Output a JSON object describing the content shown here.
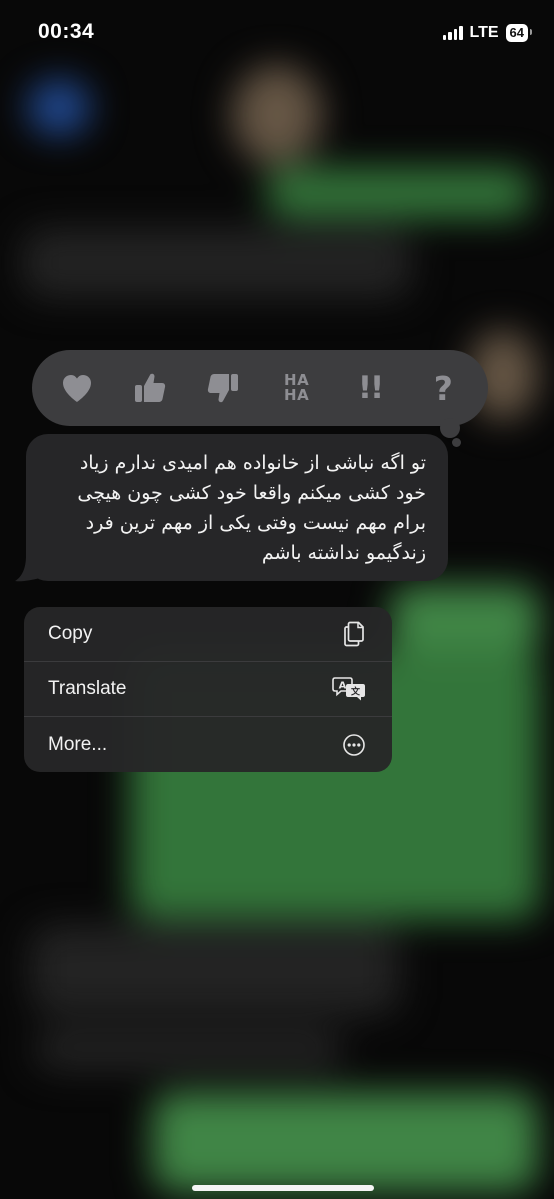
{
  "status_bar": {
    "time": "00:34",
    "network": "LTE",
    "battery": "64"
  },
  "tapback": {
    "reactions": [
      {
        "name": "heart-icon"
      },
      {
        "name": "thumbs-up-icon"
      },
      {
        "name": "thumbs-down-icon"
      },
      {
        "name": "haha-icon",
        "line1": "HA",
        "line2": "HA"
      },
      {
        "name": "exclamation-icon",
        "text": "!!"
      },
      {
        "name": "question-icon",
        "text": "?"
      }
    ],
    "icon_color": "#8e8e93",
    "background": "#3d3d3f"
  },
  "message": {
    "text": "تو اگه نباشی از خانواده هم امیدی ندارم زیاد خود کشی میکنم واقعا خود کشی چون هیچی برام مهم نیست وفتی یکی از مهم ترین فرد زندگیمو نداشته باشم",
    "bubble_color": "#262628"
  },
  "context_menu": {
    "items": [
      {
        "label": "Copy",
        "icon": "copy-icon"
      },
      {
        "label": "Translate",
        "icon": "translate-icon"
      },
      {
        "label": "More...",
        "icon": "more-icon"
      }
    ]
  },
  "colors": {
    "background_green_bubble": "#3f8f47",
    "menu_background": "#262628"
  }
}
